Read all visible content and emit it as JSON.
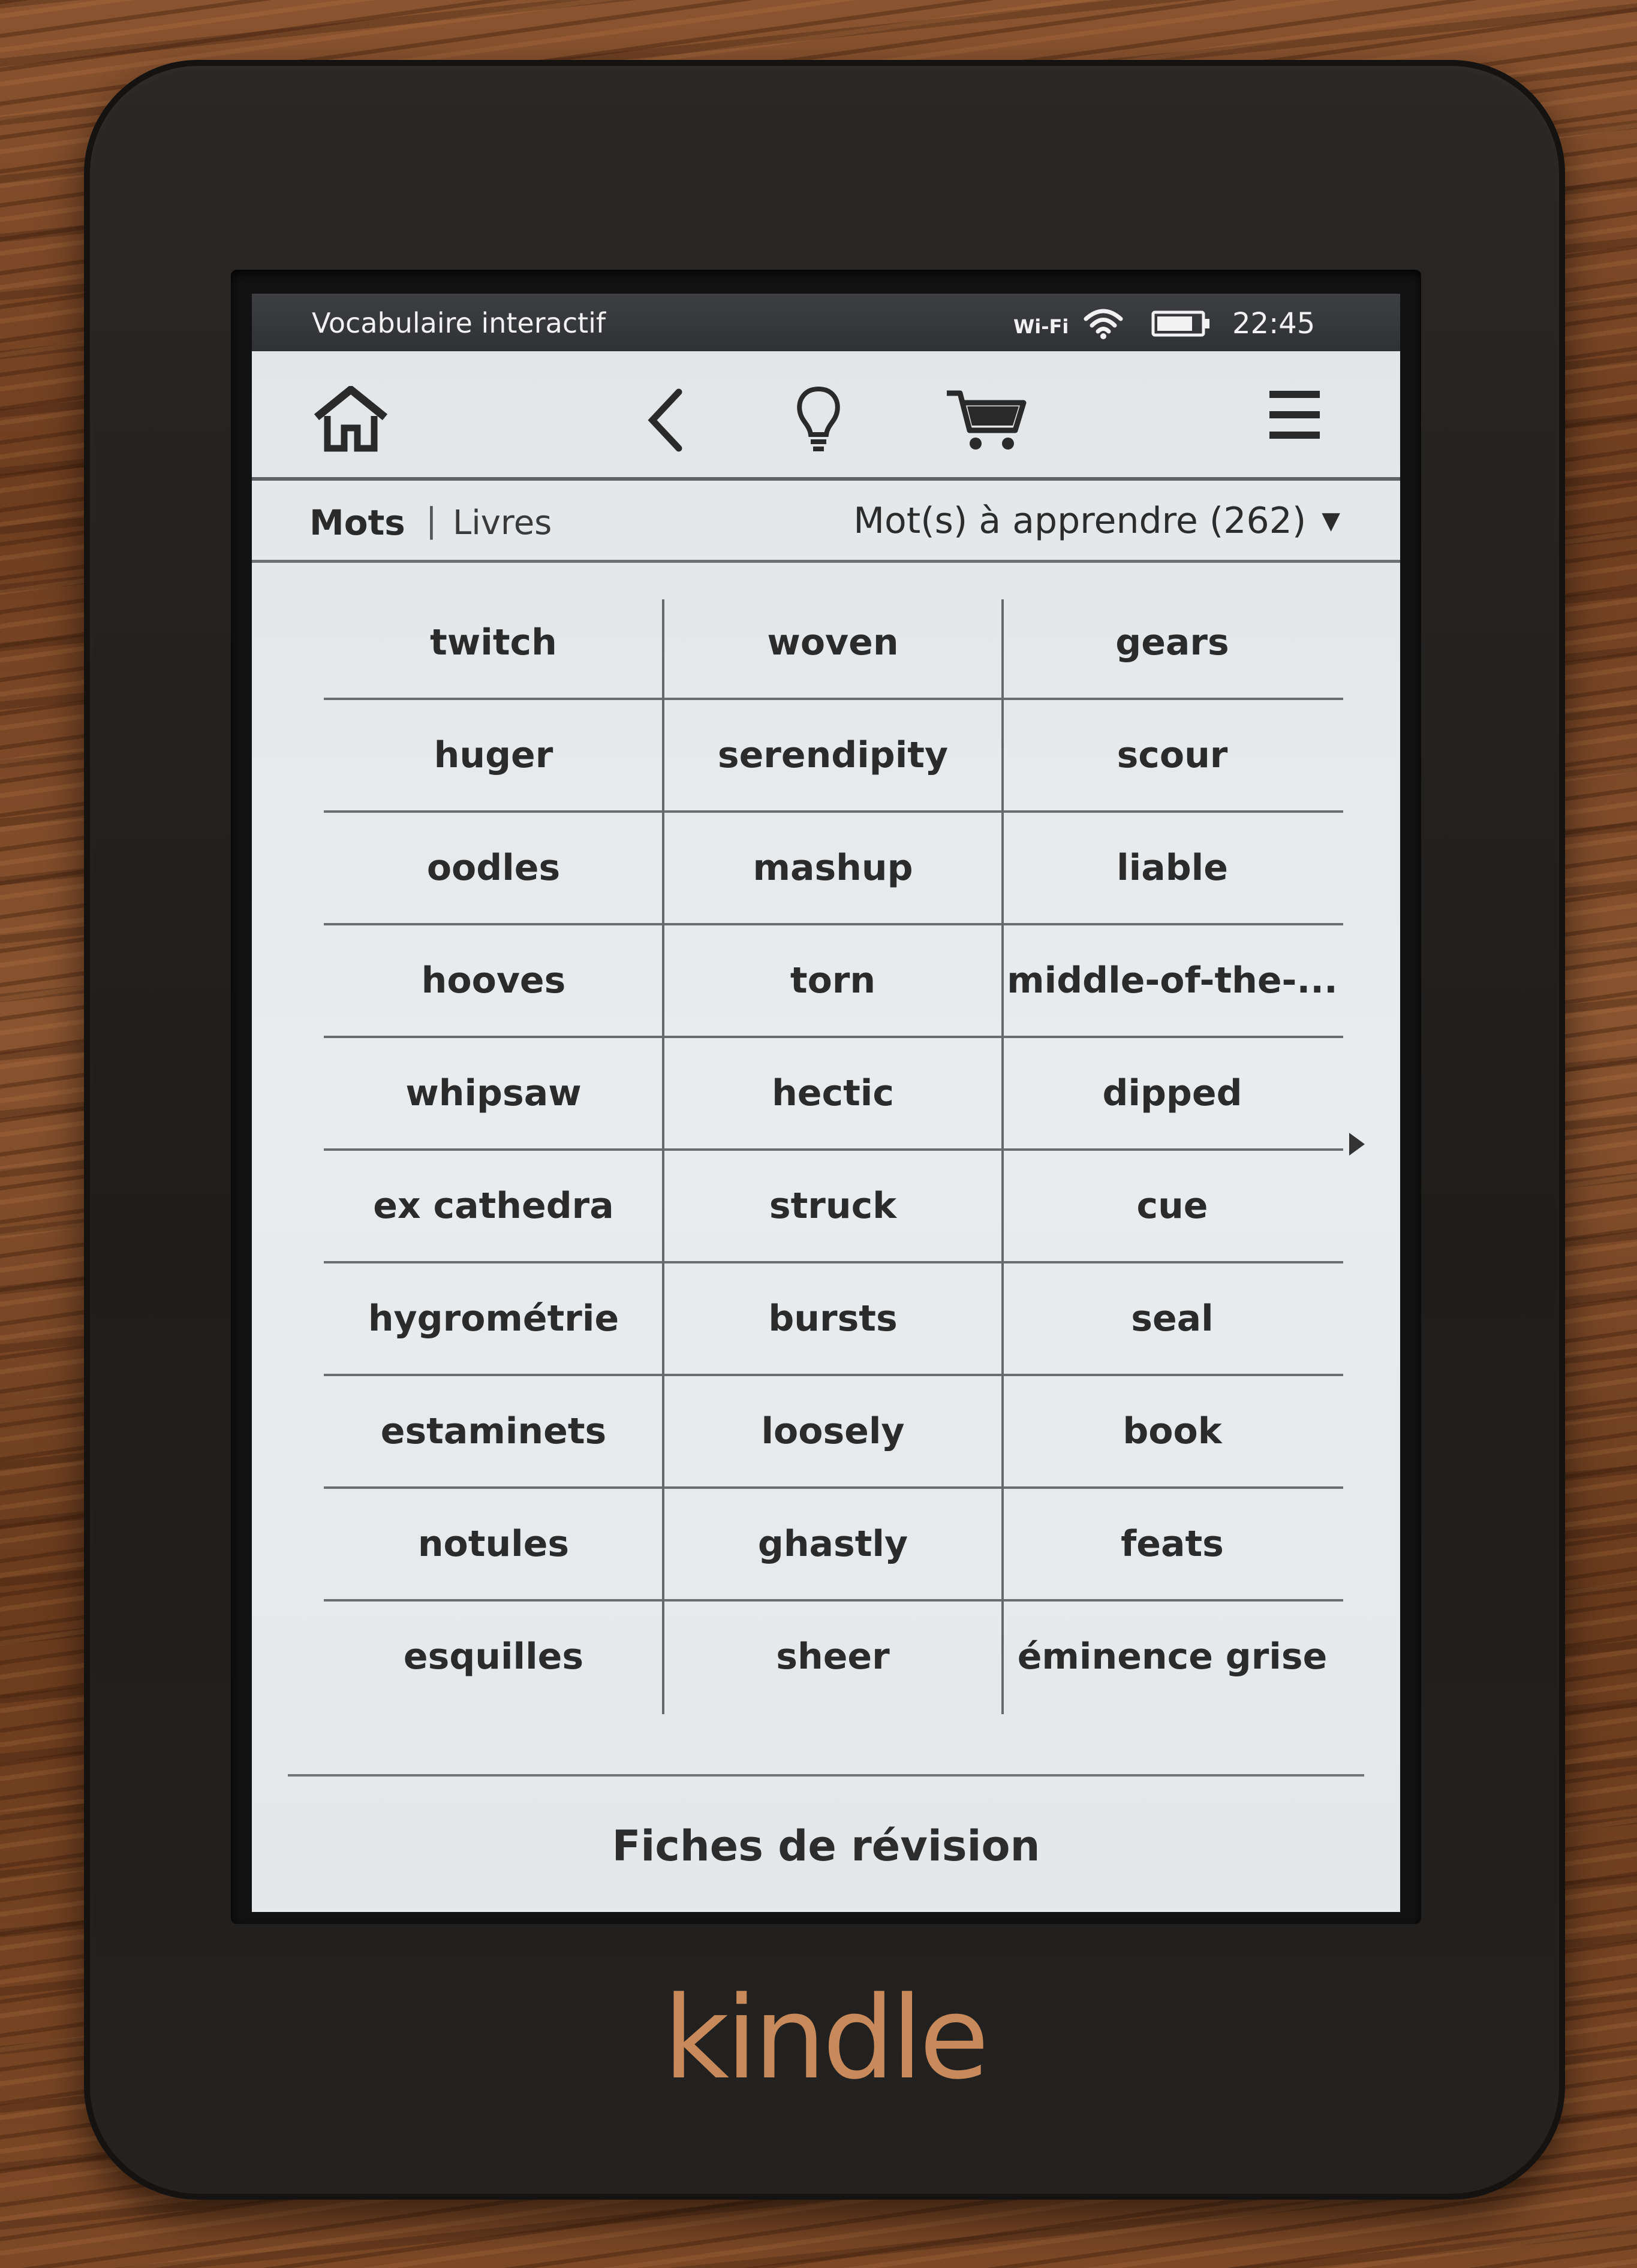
{
  "status_bar": {
    "title": "Vocabulaire interactif",
    "wifi_label": "Wi-Fi",
    "time": "22:45",
    "icons": [
      "wifi-signal-icon",
      "battery-icon"
    ]
  },
  "toolbar": {
    "icons": [
      "home-icon",
      "back-icon",
      "lightbulb-icon",
      "cart-icon",
      "menu-icon"
    ]
  },
  "tabs": {
    "words": "Mots",
    "separator": "|",
    "books": "Livres",
    "filter": "Mot(s) à apprendre (262)",
    "filter_caret": "▼"
  },
  "word_grid": [
    [
      "twitch",
      "woven",
      "gears"
    ],
    [
      "huger",
      "serendipity",
      "scour"
    ],
    [
      "oodles",
      "mashup",
      "liable"
    ],
    [
      "hooves",
      "torn",
      "middle-of-the-..."
    ],
    [
      "whipsaw",
      "hectic",
      "dipped"
    ],
    [
      "ex cathedra",
      "struck",
      "cue"
    ],
    [
      "hygrométrie",
      "bursts",
      "seal"
    ],
    [
      "estaminets",
      "loosely",
      "book"
    ],
    [
      "notules",
      "ghastly",
      "feats"
    ],
    [
      "esquilles",
      "sheer",
      "éminence grise"
    ]
  ],
  "footer": {
    "flashcards": "Fiches de révision"
  },
  "device_brand": "kindle"
}
